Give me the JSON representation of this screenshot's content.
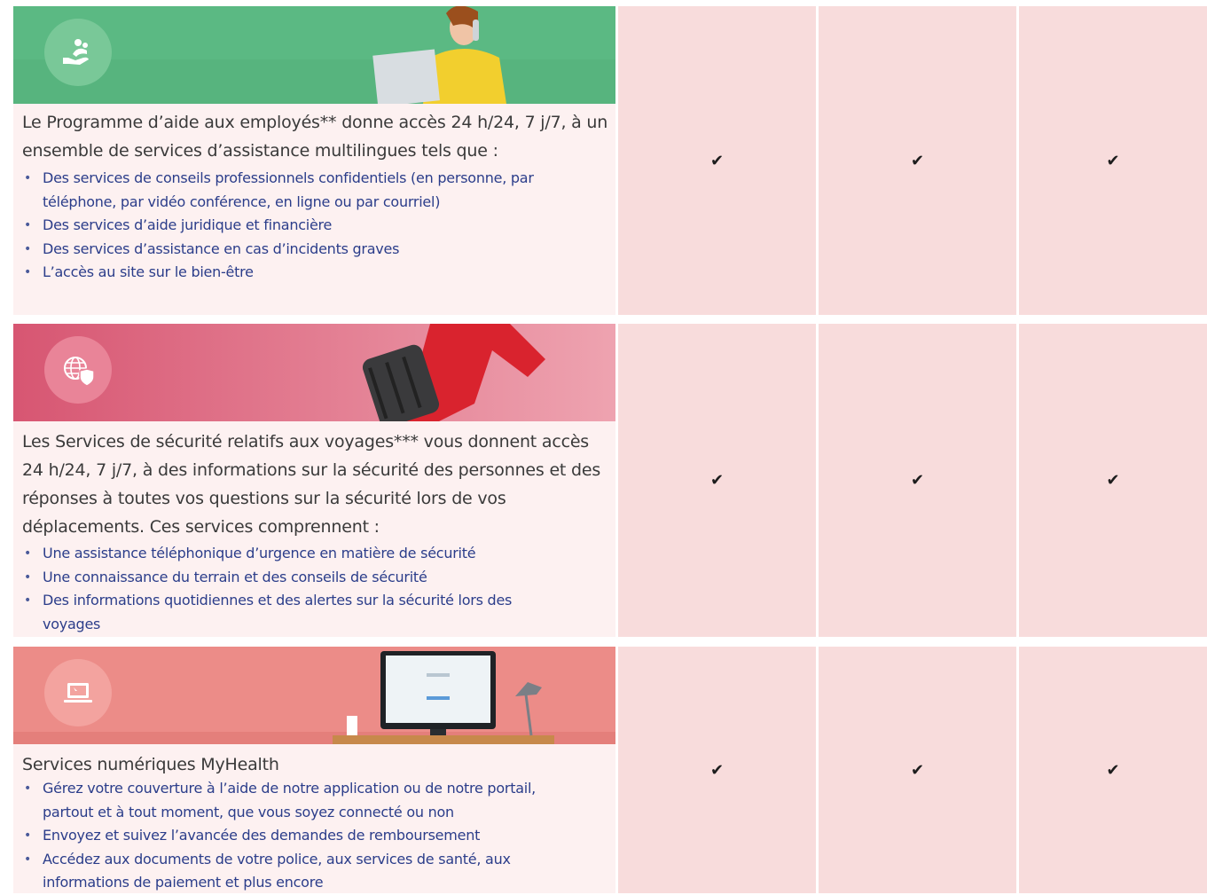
{
  "rows": [
    {
      "icon": "hand-care-icon",
      "lead": "Le Programme d’aide aux employés** donne accès 24 h/24, 7 j/7, à un ensemble de services d’assistance multilingues tels que :",
      "bullets": [
        "Des services de conseils professionnels confidentiels (en personne, par téléphone, par vidéo conférence, en ligne ou par courriel)",
        "Des services d’aide juridique et financière",
        "Des services d’assistance en cas d’incidents graves",
        "L’accès au site sur le bien-être"
      ],
      "checks": [
        "✔",
        "✔",
        "✔"
      ]
    },
    {
      "icon": "globe-shield-icon",
      "lead": "Les Services de sécurité relatifs aux voyages*** vous donnent accès 24 h/24, 7 j/7, à des informations sur la sécurité des personnes et des réponses à toutes vos questions sur la sécurité lors de vos déplacements. Ces services comprennent :",
      "bullets": [
        "Une assistance téléphonique d’urgence en matière de sécurité",
        "Une connaissance du terrain et des conseils de sécurité",
        "Des informations quotidiennes et des alertes sur la sécurité lors des voyages"
      ],
      "checks": [
        "✔",
        "✔",
        "✔"
      ]
    },
    {
      "icon": "laptop-icon",
      "lead": "Services numériques MyHealth",
      "bullets": [
        "Gérez votre couverture à l’aide de notre application ou de notre portail, partout et à tout moment, que vous soyez connecté ou non",
        "Envoyez et suivez l’avancée des demandes de remboursement",
        "Accédez aux documents de votre police, aux services de santé, aux informations de paiement et plus encore"
      ],
      "checks": [
        "✔",
        "✔",
        "✔"
      ]
    }
  ],
  "colors": {
    "row_bg": "#fdf1f1",
    "check_col_bg": "#f8dcdc",
    "bullet_text": "#2b3d8a",
    "banner1": "#5bb983",
    "banner2": "#d9607a",
    "banner3": "#ec8c88"
  }
}
